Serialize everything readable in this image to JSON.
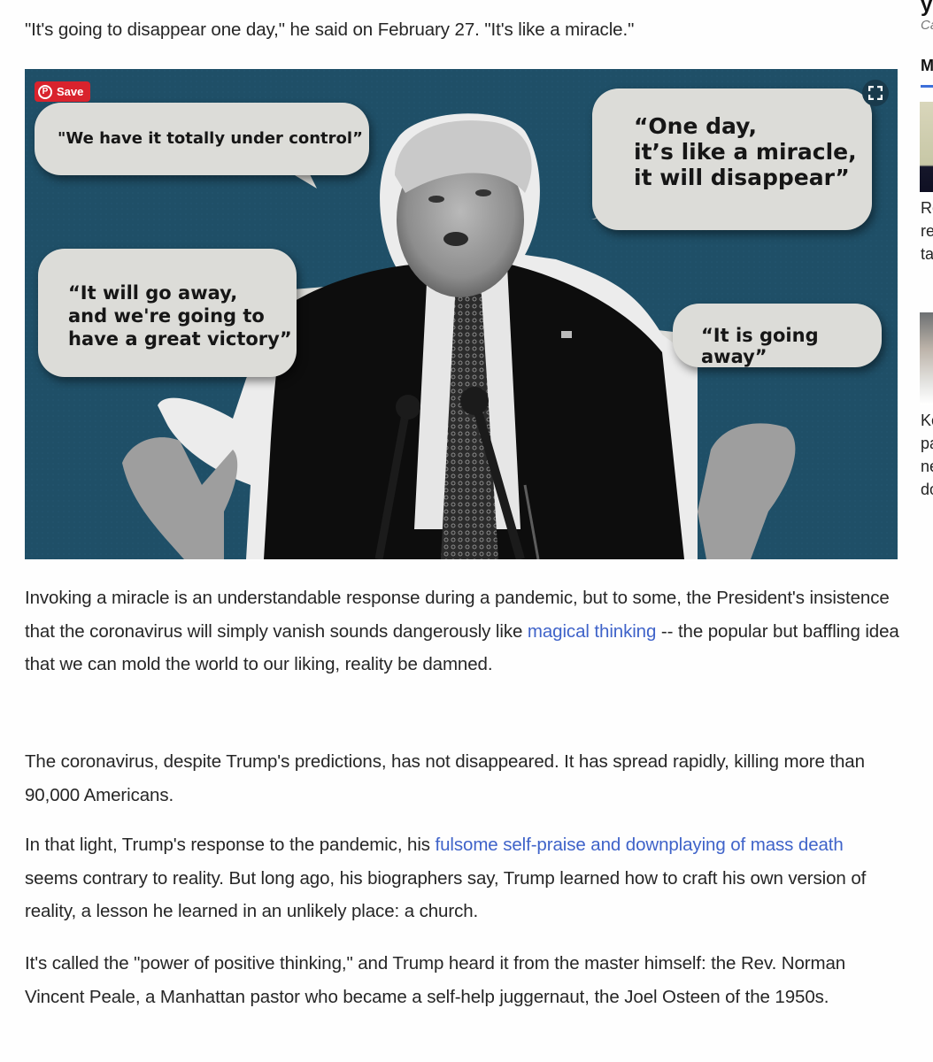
{
  "article": {
    "quote_line": "\"It's going to disappear one day,\" he said on February 27. \"It's like a miracle.\"",
    "figure": {
      "pin_save_label": "Save",
      "pin_icon": "pinterest-icon",
      "expand_icon": "fullscreen-icon",
      "bubbles": [
        "\"We have it totally under control”",
        "“One day,\nit’s like a miracle,\nit will disappear”",
        "“It will go away,\nand we're going to\nhave a great victory”",
        "“It is going away”"
      ]
    },
    "paragraphs": [
      {
        "before": "Invoking a miracle is an understandable response during a pandemic, but to some, the President's insistence that the coronavirus will simply vanish sounds dangerously like ",
        "link": "magical thinking",
        "after": " -- the popular but baffling idea that we can mold the world to our liking, reality be damned."
      },
      {
        "text": "The coronavirus, despite Trump's predictions, has not disappeared. It has spread rapidly, killing more than 90,000 Americans."
      },
      {
        "before": "In that light, Trump's response to the pandemic, his ",
        "link": "fulsome self-praise and downplaying of mass death",
        "after": " seems contrary to reality. But long ago, his biographers say, Trump learned how to craft his own version of reality, a lesson he learned in an unlikely place: a church."
      },
      {
        "text": "It's called the \"power of positive thinking,\" and Trump heard it from the master himself: the Rev. Norman Vincent Peale, a Manhattan pastor who became a self-help juggernaut, the Joel Osteen of the 1950s."
      }
    ],
    "link_color": "#3f63c9"
  },
  "sidebar": {
    "title_fragment": "yo",
    "subtitle_fragment": "Ca",
    "section_fragment": "M",
    "items": [
      {
        "text_fragment": "Re\nre\nta"
      },
      {
        "text_fragment": "Ko\npa\nne\ndo"
      }
    ]
  }
}
